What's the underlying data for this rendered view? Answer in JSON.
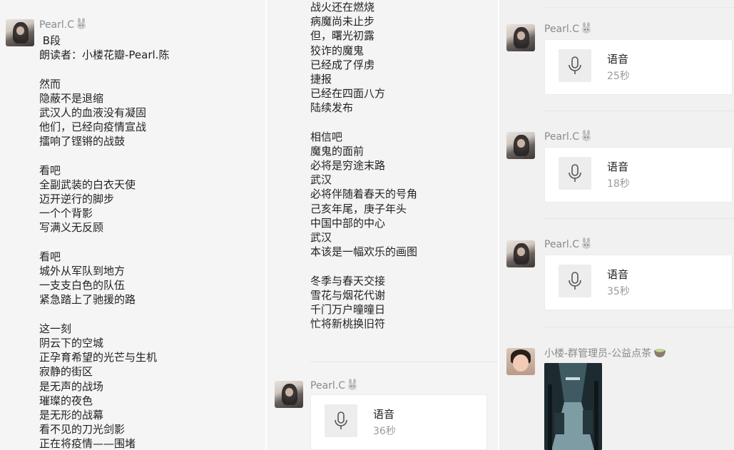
{
  "colors": {
    "sender": "#8a8a8a",
    "bubble": "#ffffff",
    "background": "#f3f3f3"
  },
  "panel1": {
    "sender": "Pearl.C",
    "poem": [
      " B段",
      "朗读者：小楼花瓣-Pearl.陈",
      "",
      "然而",
      "隐蔽不是退缩",
      "武汉人的血液没有凝固",
      "他们，已经向疫情宣战",
      "擂响了铿锵的战鼓",
      "",
      "看吧",
      "全副武装的白衣天使",
      "迈开逆行的脚步",
      "一个个背影",
      "写满义无反顾",
      "",
      "看吧",
      "城外从军队到地方",
      "一支支白色的队伍",
      "紧急踏上了驰援的路",
      "",
      "这一刻",
      "阴云下的空城",
      "正孕育希望的光芒与生机",
      "寂静的街区",
      "是无声的战场",
      "璀璨的夜色",
      "是无形的战幕",
      "看不见的刀光剑影",
      "正在将疫情——围堵"
    ]
  },
  "panel2": {
    "poem": [
      "战火还在燃烧",
      "病魔尚未止步",
      "但，曙光初露",
      "狡诈的魔鬼",
      "已经成了俘虏",
      "捷报",
      "已经在四面八方",
      "陆续发布",
      "",
      "相信吧",
      "魔鬼的面前",
      "必将是穷途末路",
      "武汉",
      "必将伴随着春天的号角",
      "己亥年尾，庚子年头",
      "中国中部的中心",
      "武汉",
      "本该是一幅欢乐的画图",
      "",
      "冬季与春天交接",
      "雪花与烟花代谢",
      "千门万户曈曈日",
      "忙将新桃换旧符"
    ],
    "voice": {
      "sender": "Pearl.C",
      "label": "语音",
      "duration": "36秒"
    }
  },
  "panel3": {
    "voices": [
      {
        "sender": "Pearl.C",
        "label": "语音",
        "duration": "25秒"
      },
      {
        "sender": "Pearl.C",
        "label": "语音",
        "duration": "18秒"
      },
      {
        "sender": "Pearl.C",
        "label": "语音",
        "duration": "35秒"
      }
    ],
    "last_sender": "小楼-群管理员-公益点茶",
    "icons": {
      "rabbit": "rabbit-emoji-icon",
      "mic": "microphone-icon",
      "tea": "tea-bowl-emoji-icon"
    }
  }
}
